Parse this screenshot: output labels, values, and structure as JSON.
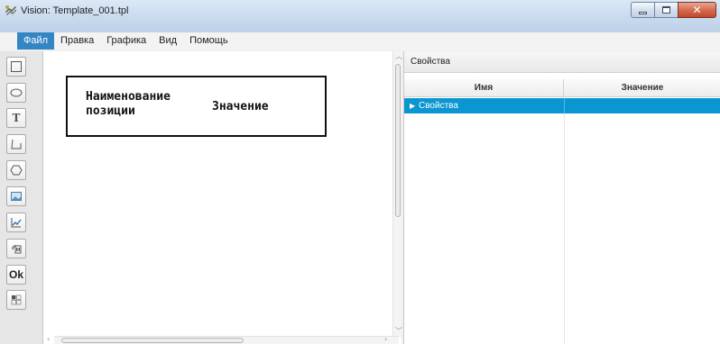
{
  "window": {
    "title": "Vision: Template_001.tpl",
    "controls": [
      "minimize-icon",
      "maximize-icon",
      "close-icon"
    ]
  },
  "menu": {
    "items": [
      "Файл",
      "Правка",
      "Графика",
      "Вид",
      "Помощь"
    ],
    "active": "Файл"
  },
  "toolbar": {
    "tools": [
      {
        "name": "rectangle-tool",
        "icon": "rectangle-icon"
      },
      {
        "name": "ellipse-tool",
        "icon": "ellipse-icon"
      },
      {
        "name": "text-tool",
        "icon": "text-icon",
        "label": "T"
      },
      {
        "name": "polyline-tool",
        "icon": "polyline-icon"
      },
      {
        "name": "polygon-tool",
        "icon": "hexagon-icon"
      },
      {
        "name": "image-tool",
        "icon": "image-icon"
      },
      {
        "name": "chart-tool",
        "icon": "chart-icon"
      },
      {
        "name": "barcode-tool",
        "icon": "barcode-icon"
      },
      {
        "name": "ok-button-tool",
        "icon": "ok-icon",
        "label": "Ok"
      },
      {
        "name": "grid-tool",
        "icon": "grid-icon"
      }
    ]
  },
  "canvas": {
    "template_box": {
      "name_label": "Наименование позиции",
      "value_label": "Значение"
    }
  },
  "properties": {
    "panel_title": "Свойства",
    "columns": [
      "Имя",
      "Значение"
    ],
    "rows": [
      {
        "name": "Свойства",
        "value": "",
        "selected": true,
        "expandable": true
      }
    ],
    "colors": {
      "selected_row": "#0a96d0",
      "menu_active": "#3485c3"
    }
  }
}
